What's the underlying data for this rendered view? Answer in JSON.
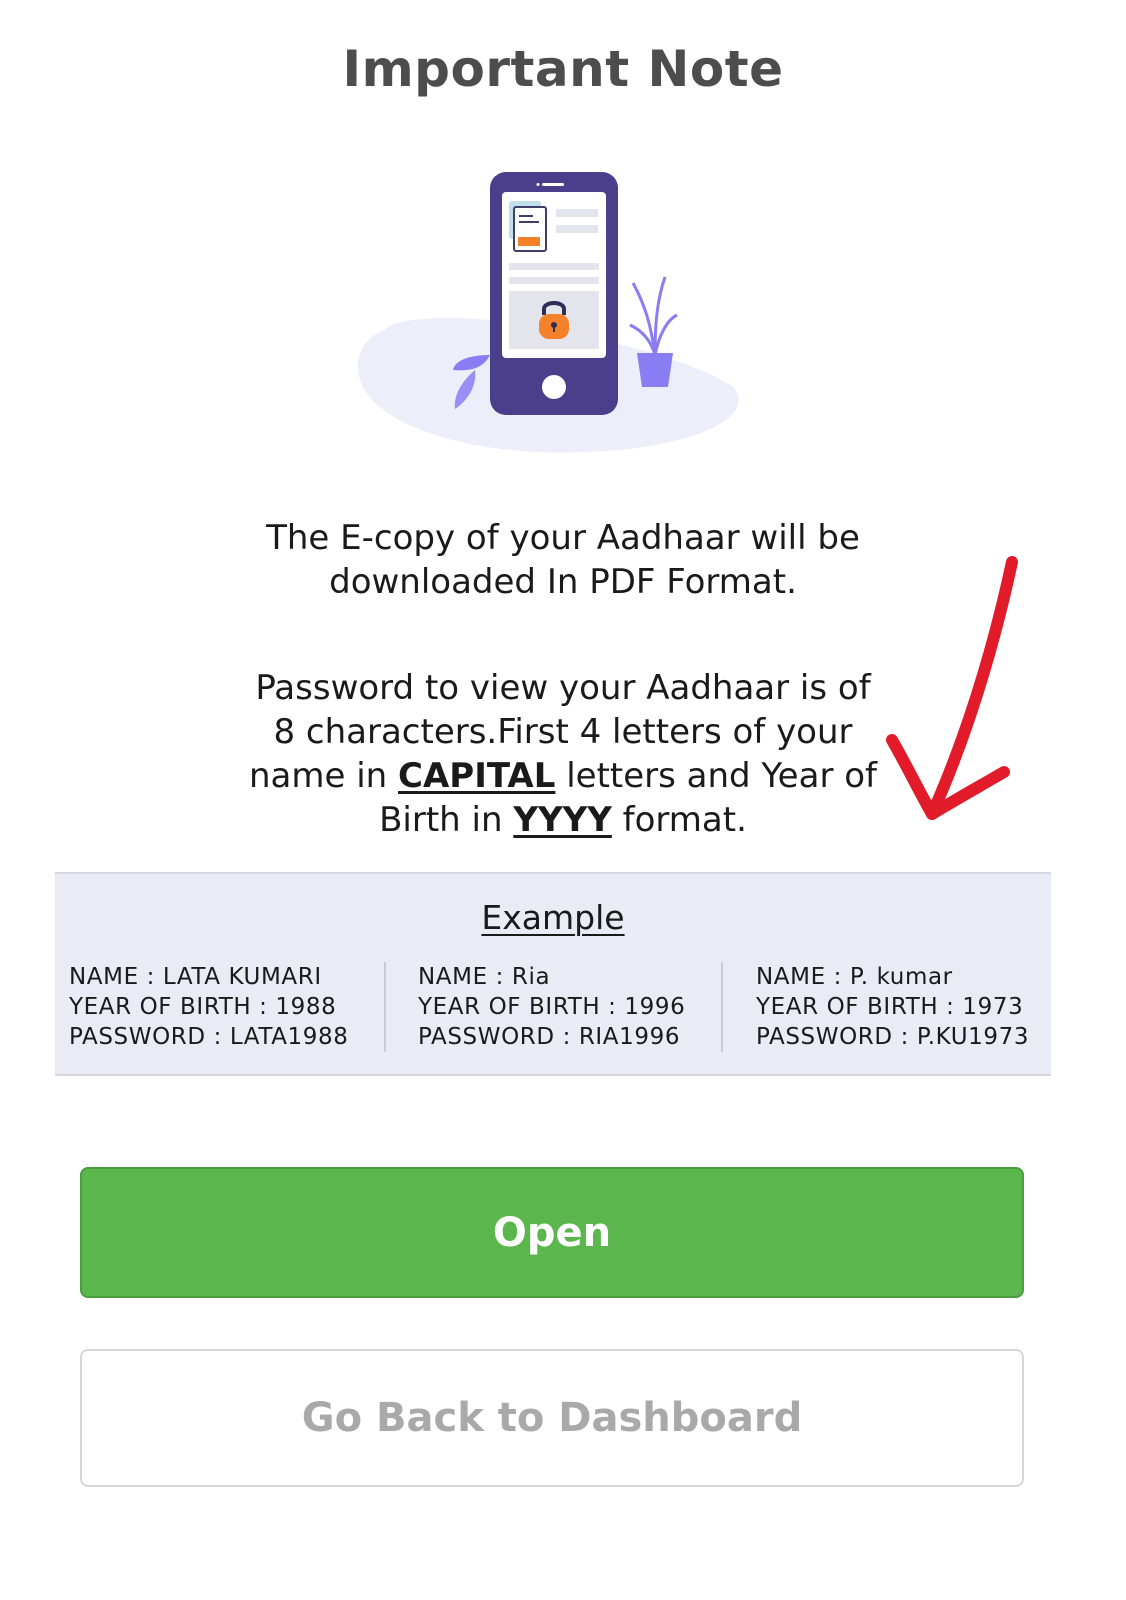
{
  "header": {
    "title": "Important Note"
  },
  "illustration": {
    "icon": "phone-lock-illustration",
    "colors": {
      "phone": "#4b3f8c",
      "blob": "#eceefa",
      "lock": "#f5822a",
      "plant": "#8a7cf2"
    }
  },
  "notice": {
    "line1": "The E-copy of your Aadhaar will be",
    "line2": "downloaded In PDF Format."
  },
  "password_info": {
    "line1": "Password to view your Aadhaar is of",
    "line2": "8 characters.First 4 letters of your",
    "line3_pre": "name in ",
    "line3_bold": "CAPITAL",
    "line3_post": " letters and Year of",
    "line4_pre": "Birth in ",
    "line4_bold": "YYYY",
    "line4_post": " format."
  },
  "annotation": {
    "icon": "red-arrow-icon",
    "color": "#e11b2a"
  },
  "example": {
    "title": "Example",
    "items": [
      {
        "name": "NAME : LATA KUMARI",
        "year": "YEAR OF BIRTH : 1988",
        "password": "PASSWORD : LATA1988"
      },
      {
        "name": "NAME : Ria",
        "year": "YEAR OF BIRTH : 1996",
        "password": "PASSWORD : RIA1996"
      },
      {
        "name": "NAME : P. kumar",
        "year": "YEAR OF BIRTH : 1973",
        "password": "PASSWORD : P.KU1973"
      }
    ]
  },
  "actions": {
    "open_label": "Open",
    "back_label": "Go Back to Dashboard",
    "open_color": "#5cb64e"
  }
}
